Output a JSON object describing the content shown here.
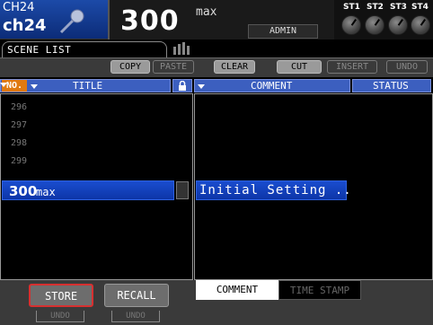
{
  "header": {
    "channel_id": "CH24",
    "channel_name": "ch24",
    "scene_number": "300",
    "scene_title": "max",
    "user": "ADMIN",
    "stereo_labels": [
      "ST1",
      "ST2",
      "ST3",
      "ST4"
    ]
  },
  "tab": {
    "label": "SCENE LIST"
  },
  "toolbar": {
    "copy": "COPY",
    "paste": "PASTE",
    "clear": "CLEAR",
    "cut": "CUT",
    "insert": "INSERT",
    "undo": "UNDO"
  },
  "columns": {
    "no": "NO.",
    "title": "TITLE",
    "comment": "COMMENT",
    "status": "STATUS"
  },
  "rows": [
    {
      "num": "296"
    },
    {
      "num": "297"
    },
    {
      "num": "298"
    },
    {
      "num": "299"
    }
  ],
  "selected": {
    "num": "300",
    "title": "max",
    "comment": "Initial Setting .."
  },
  "bottom": {
    "store": "STORE",
    "recall": "RECALL",
    "store_undo": "UNDO",
    "recall_undo": "UNDO",
    "tab_comment": "COMMENT",
    "tab_timestamp": "TIME STAMP"
  },
  "colors": {
    "selection": "#1a4dcf",
    "header_blue": "#3c5fbf",
    "sort_orange": "#e07a10",
    "store_border": "#d73030"
  }
}
